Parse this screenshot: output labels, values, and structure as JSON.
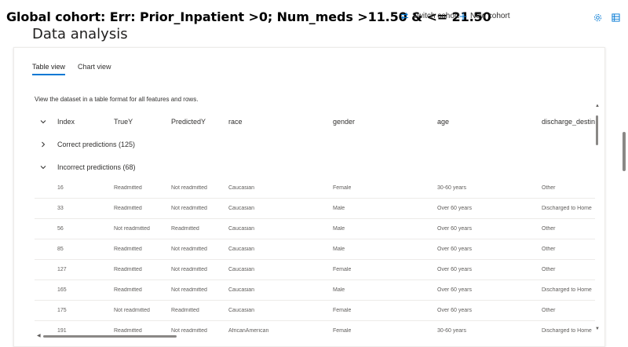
{
  "header": {
    "cohort_title": "Global cohort: Err: Prior_Inpatient >0; Num_meds >11.50 & <= 21.50",
    "switch_cohort_label": "Switch cohort",
    "new_cohort_label": "New cohort",
    "accent_color": "#0078d4"
  },
  "section": {
    "title": "Data analysis",
    "tabs": [
      {
        "label": "Table view",
        "active": true
      },
      {
        "label": "Chart view",
        "active": false
      }
    ],
    "description": "View the dataset in a table format for all features and rows."
  },
  "table": {
    "columns": [
      "Index",
      "TrueY",
      "PredictedY",
      "race",
      "gender",
      "age",
      "discharge_destina"
    ],
    "groups": [
      {
        "label": "Correct predictions (125)",
        "expanded": false
      },
      {
        "label": "Incorrect predictions (68)",
        "expanded": true
      }
    ],
    "rows": [
      [
        "16",
        "Readmitted",
        "Not readmitted",
        "Caucasian",
        "Female",
        "30-60 years",
        "Other"
      ],
      [
        "33",
        "Readmitted",
        "Not readmitted",
        "Caucasian",
        "Male",
        "Over 60 years",
        "Discharged to Home"
      ],
      [
        "56",
        "Not readmitted",
        "Readmitted",
        "Caucasian",
        "Male",
        "Over 60 years",
        "Other"
      ],
      [
        "85",
        "Readmitted",
        "Not readmitted",
        "Caucasian",
        "Male",
        "Over 60 years",
        "Other"
      ],
      [
        "127",
        "Readmitted",
        "Not readmitted",
        "Caucasian",
        "Female",
        "Over 60 years",
        "Other"
      ],
      [
        "165",
        "Readmitted",
        "Not readmitted",
        "Caucasian",
        "Male",
        "Over 60 years",
        "Discharged to Home"
      ],
      [
        "175",
        "Not readmitted",
        "Readmitted",
        "Caucasian",
        "Female",
        "Over 60 years",
        "Other"
      ],
      [
        "191",
        "Readmitted",
        "Not readmitted",
        "AfricanAmerican",
        "Female",
        "30-60 years",
        "Discharged to Home"
      ]
    ]
  }
}
